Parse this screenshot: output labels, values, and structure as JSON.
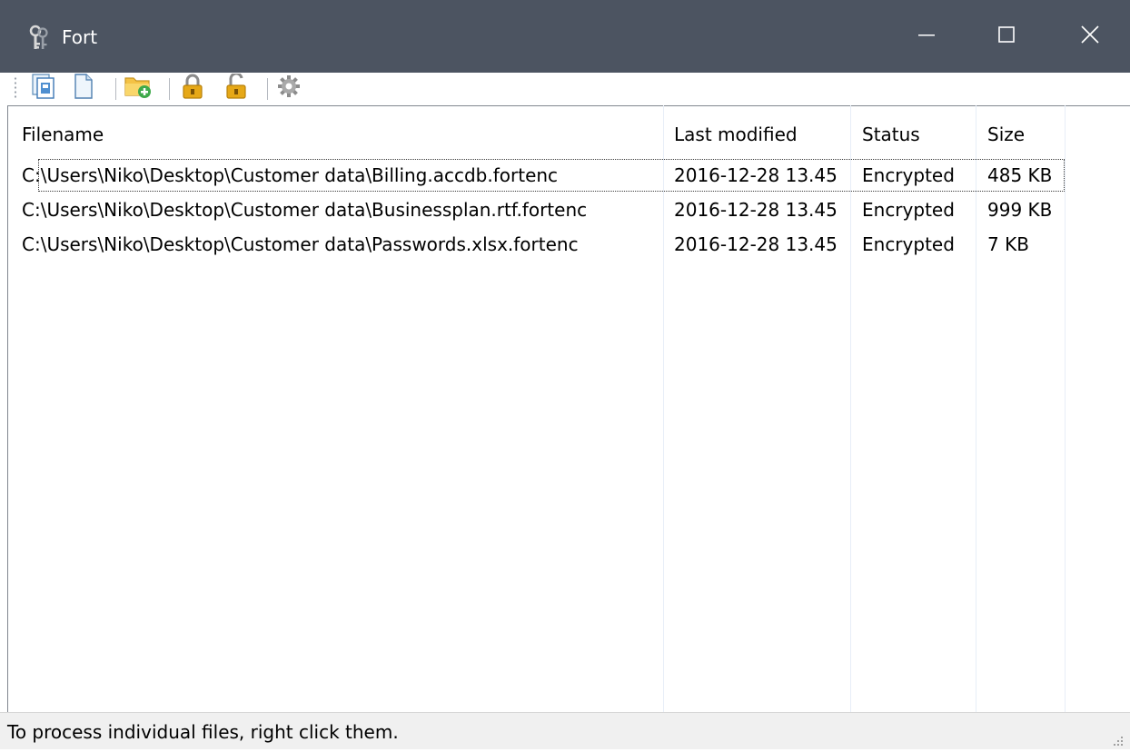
{
  "window": {
    "title": "Fort",
    "app_icon": "keys-icon",
    "controls": {
      "minimize_icon": "minimize-icon",
      "maximize_icon": "maximize-icon",
      "close_icon": "close-icon"
    }
  },
  "toolbar": {
    "buttons": [
      {
        "name": "open-files-button",
        "icon": "open-files-icon"
      },
      {
        "name": "new-file-button",
        "icon": "document-icon"
      },
      {
        "name": "add-folder-button",
        "icon": "add-folder-icon"
      },
      {
        "name": "encrypt-button",
        "icon": "lock-icon"
      },
      {
        "name": "decrypt-button",
        "icon": "unlock-icon"
      },
      {
        "name": "settings-button",
        "icon": "gear-icon"
      }
    ]
  },
  "list": {
    "columns": [
      "Filename",
      "Last modified",
      "Status",
      "Size"
    ],
    "rows": [
      [
        "C:\\Users\\Niko\\Desktop\\Customer data\\Billing.accdb.fortenc",
        "2016-12-28 13.45",
        "Encrypted",
        "485 KB"
      ],
      [
        "C:\\Users\\Niko\\Desktop\\Customer data\\Businessplan.rtf.fortenc",
        "2016-12-28 13.45",
        "Encrypted",
        "999 KB"
      ],
      [
        "C:\\Users\\Niko\\Desktop\\Customer data\\Passwords.xlsx.fortenc",
        "2016-12-28 13.45",
        "Encrypted",
        "7 KB"
      ]
    ],
    "focused_row": 0
  },
  "statusbar": {
    "text": "To process individual files, right click them."
  },
  "colors": {
    "titlebar": "#4c5461",
    "statusbar": "#f0f0f0",
    "grid_line": "#e7eef7"
  }
}
